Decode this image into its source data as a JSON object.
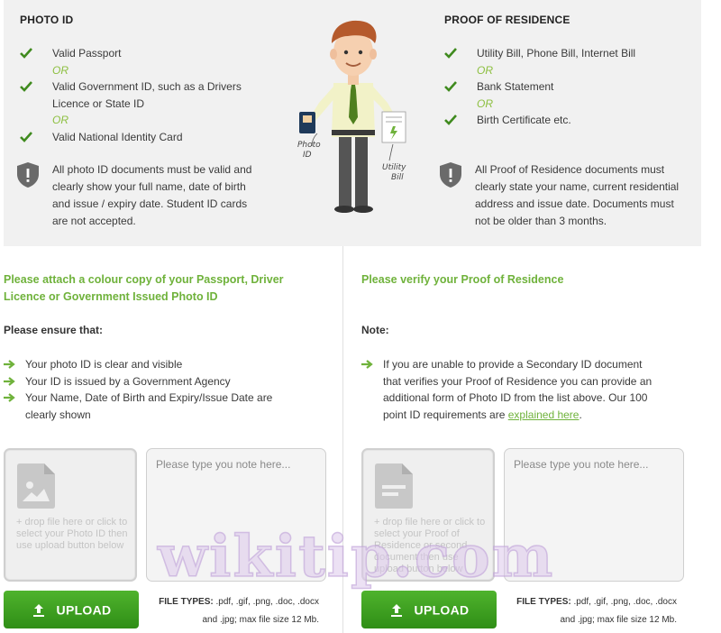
{
  "photo_id": {
    "title": "PHOTO ID",
    "items": [
      {
        "text": "Valid Passport"
      },
      {
        "or": "OR"
      },
      {
        "text": "Valid Government ID, such as a Drivers Licence or State ID"
      },
      {
        "or": "OR"
      },
      {
        "text": "Valid National Identity Card"
      }
    ],
    "note": "All photo ID documents must be valid and clearly show your full name, date of birth and issue / expiry date. Student ID cards are not accepted."
  },
  "residence": {
    "title": "PROOF OF RESIDENCE",
    "items": [
      {
        "text": "Utility Bill, Phone Bill, Internet Bill"
      },
      {
        "or": "OR"
      },
      {
        "text": "Bank Statement"
      },
      {
        "or": "OR"
      },
      {
        "text": "Birth Certificate etc."
      }
    ],
    "note": "All Proof of Residence documents must clearly state your name, current residential address and issue date. Documents must not be older than 3 months."
  },
  "illustration": {
    "photo_id_label": "Photo ID",
    "utility_bill_label": "Utility Bill"
  },
  "left_section": {
    "heading": "Please attach a colour copy of your Passport, Driver Licence or Government Issued Photo ID",
    "subheading": "Please ensure that:",
    "bullets": [
      "Your photo ID is clear and visible",
      "Your ID is issued by a Government Agency",
      "Your Name, Date of Birth and Expiry/Issue Date are clearly shown"
    ],
    "drop_text": "+ drop file here or click to select your Photo ID then use upload button below",
    "note_placeholder": "Please type you note here...",
    "upload_label": "UPLOAD",
    "file_types_label": "FILE TYPES:",
    "file_types_text": " .pdf, .gif, .png, .doc, .docx and .jpg; max file size 12 Mb."
  },
  "right_section": {
    "heading": "Please verify your Proof of Residence",
    "subheading": "Note:",
    "bullet_text": "If you are unable to provide a Secondary ID document that verifies your Proof of Residence you can provide an additional form of Photo ID from the list above. Our 100 point ID requirements are",
    "bullet_link": "explained here",
    "bullet_end": ".",
    "drop_text": "+ drop file here or click to select your Proof of Residence or second document then use upload button below",
    "note_placeholder": "Please type you note here...",
    "upload_label": "UPLOAD",
    "file_types_label": "FILE TYPES:",
    "file_types_text": " .pdf, .gif, .png, .doc, .docx and .jpg; max file size 12 Mb."
  },
  "watermark": "wikitip.com",
  "colors": {
    "accent_green": "#6fb23b",
    "or_green": "#8cbf3f",
    "check_green": "#3f8a1e",
    "button_green": "#3a9c1f",
    "panel_bg": "#f1f1f1"
  }
}
